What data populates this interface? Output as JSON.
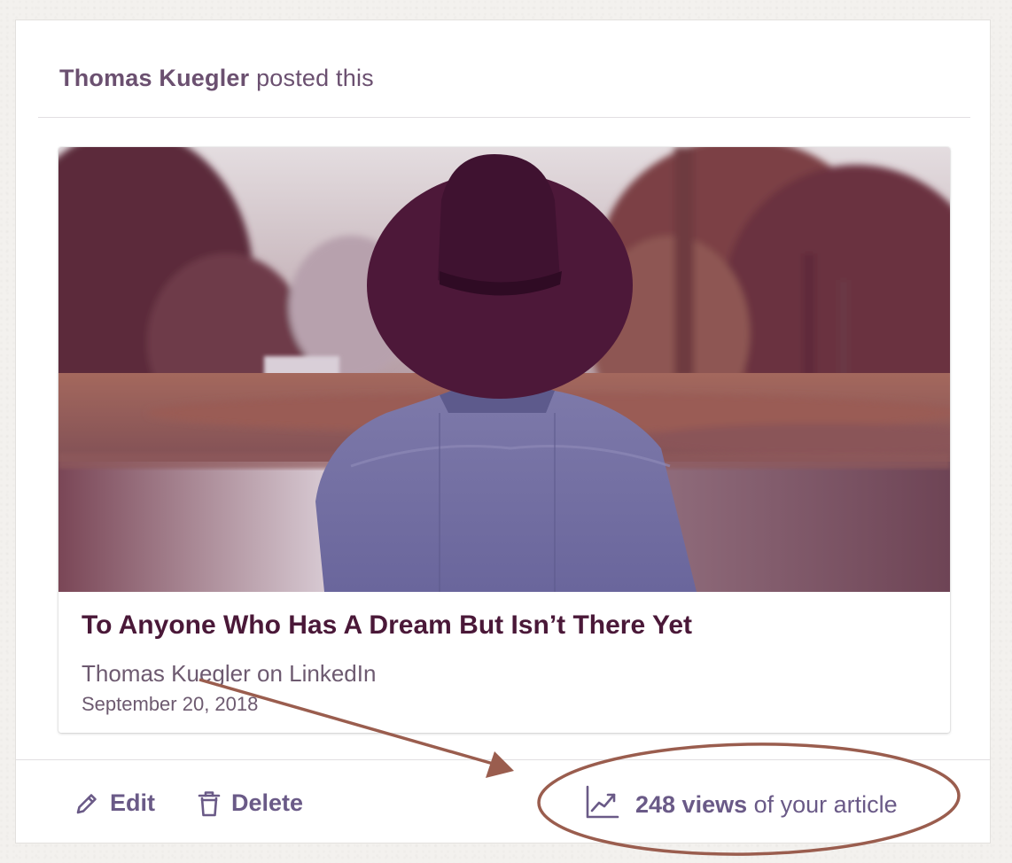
{
  "post": {
    "author": "Thomas Kuegler",
    "action_text": "posted this"
  },
  "article": {
    "title": "To Anyone Who Has A Dream But Isn’t There Yet",
    "source": "Thomas Kuegler on LinkedIn",
    "date": "September 20, 2018",
    "image_icon": "man-in-hat-photo"
  },
  "actions": {
    "edit_label": "Edit",
    "edit_icon": "pencil-icon",
    "delete_label": "Delete",
    "delete_icon": "trash-icon"
  },
  "stats": {
    "views_count": "248 views",
    "views_suffix": "of your article",
    "icon": "trend-chart-icon"
  },
  "colors": {
    "accent": "#6a5a87",
    "title": "#4a1838",
    "annotation": "#9a5d4e"
  }
}
